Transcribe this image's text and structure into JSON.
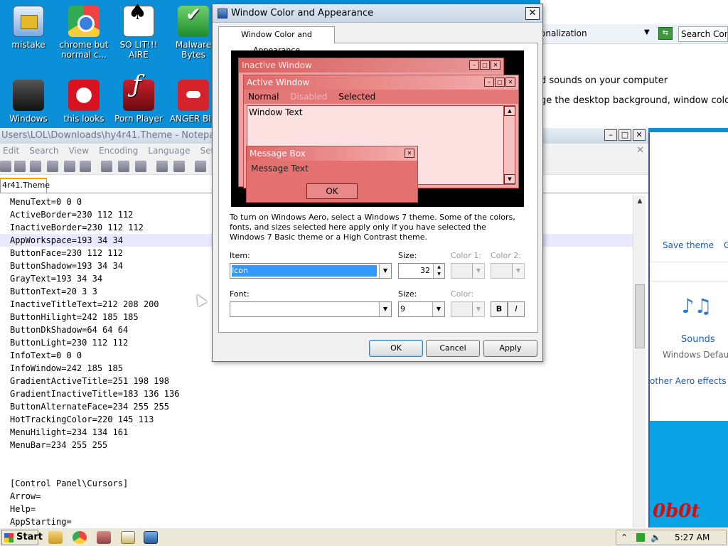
{
  "desktop": {
    "icons": [
      {
        "label": "mistake",
        "icon": "folder-image-icon"
      },
      {
        "label": "chrome but normal c...",
        "icon": "chrome-icon"
      },
      {
        "label": "SO LIT!!! AIRE",
        "icon": "playing-cards-icon"
      },
      {
        "label": "Malware Bytes",
        "icon": "shield-icon"
      },
      {
        "label": "Windows",
        "icon": "recycle-bin-icon"
      },
      {
        "label": "this looks",
        "icon": "opera-icon"
      },
      {
        "label": "Porn Player",
        "icon": "flash-player-icon"
      },
      {
        "label": "ANGER BIR",
        "icon": "angry-bird-icon"
      }
    ]
  },
  "notepad": {
    "title": "Users\\LOL\\Downloads\\hy4r41.Theme - Notepad++",
    "menu": [
      "Edit",
      "Search",
      "View",
      "Encoding",
      "Language",
      "Settin"
    ],
    "tab": "4r41.Theme",
    "lines": [
      "MenuText=0 0 0",
      "ActiveBorder=230 112 112",
      "InactiveBorder=230 112 112",
      "AppWorkspace=193 34 34",
      "ButtonFace=230 112 112",
      "ButtonShadow=193 34 34",
      "GrayText=193 34 34",
      "ButtonText=20 3 3",
      "InactiveTitleText=212 208 200",
      "ButtonHilight=242 185 185",
      "ButtonDkShadow=64 64 64",
      "ButtonLight=230 112 112",
      "InfoText=0 0 0",
      "InfoWindow=242 185 185",
      "GradientActiveTitle=251 198 198",
      "GradientInactiveTitle=183 136 136",
      "ButtonAlternateFace=234 255 255",
      "HotTrackingColor=220 145 113",
      "MenuHilight=234 134 161",
      "MenuBar=234 255 255",
      "",
      "",
      "[Control Panel\\Cursors]",
      "Arrow=",
      "Help=",
      "AppStarting="
    ],
    "highlighted_line": 3
  },
  "personalization": {
    "breadcrumb": "onalization",
    "search_placeholder": "Search Con",
    "text1": "d sounds on your computer",
    "text2": "ge the desktop background, window color, s",
    "save_theme": "Save theme",
    "save_trailing": "G",
    "sounds_label": "Sounds",
    "sounds_value": "Windows Defaul",
    "aero_link": "other Aero effects",
    "logo_text": "0b0t"
  },
  "dialog": {
    "title": "Window Color and Appearance",
    "tab": "Window Color and Appearance",
    "preview": {
      "inactive_title": "Inactive Window",
      "active_title": "Active Window",
      "menu_normal": "Normal",
      "menu_disabled": "Disabled",
      "menu_selected": "Selected",
      "window_text": "Window Text",
      "msgbox_title": "Message Box",
      "msgbox_text": "Message Text",
      "msgbox_ok": "OK"
    },
    "info_text": "To turn on Windows Aero, select a Windows 7 theme.  Some of the colors, fonts, and sizes selected here apply only if you have selected the Windows 7 Basic theme or a High Contrast theme.",
    "item_label": "Item:",
    "item_value": "Icon",
    "size_label": "Size:",
    "size_value": "32",
    "color1_label": "Color 1:",
    "color2_label": "Color 2:",
    "font_label": "Font:",
    "font_value": "",
    "font_size_label": "Size:",
    "font_size_value": "9",
    "font_color_label": "Color:",
    "bold_label": "B",
    "italic_label": "I",
    "ok": "OK",
    "cancel": "Cancel",
    "apply": "Apply"
  },
  "taskbar": {
    "start": "Start",
    "clock": "5:27 AM"
  }
}
